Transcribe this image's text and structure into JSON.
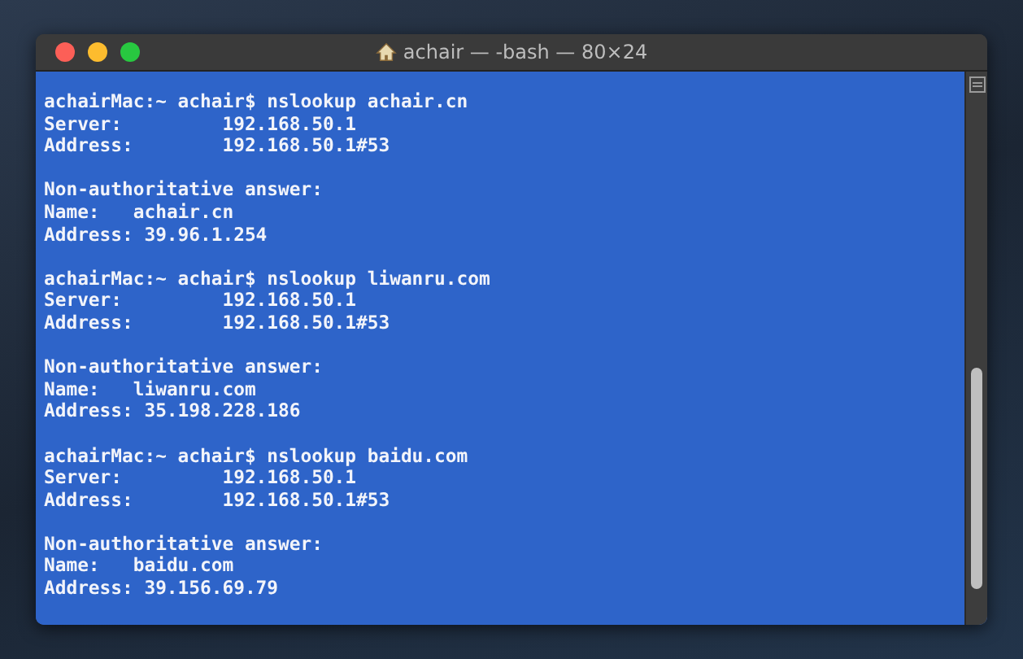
{
  "window": {
    "title": "achair — -bash — 80×24"
  },
  "terminal": {
    "blocks": [
      {
        "lines": [
          "achairMac:~ achair$ nslookup achair.cn",
          "Server:\t\t192.168.50.1",
          "Address:\t192.168.50.1#53"
        ]
      },
      {
        "lines": [
          "Non-authoritative answer:",
          "Name:\tachair.cn",
          "Address: 39.96.1.254"
        ]
      },
      {
        "lines": [
          "achairMac:~ achair$ nslookup liwanru.com",
          "Server:\t\t192.168.50.1",
          "Address:\t192.168.50.1#53"
        ]
      },
      {
        "lines": [
          "Non-authoritative answer:",
          "Name:\tliwanru.com",
          "Address: 35.198.228.186"
        ]
      },
      {
        "lines": [
          "achairMac:~ achair$ nslookup baidu.com",
          "Server:\t\t192.168.50.1",
          "Address:\t192.168.50.1#53"
        ]
      },
      {
        "lines": [
          "Non-authoritative answer:",
          "Name:\tbaidu.com",
          "Address: 39.156.69.79"
        ]
      }
    ]
  }
}
